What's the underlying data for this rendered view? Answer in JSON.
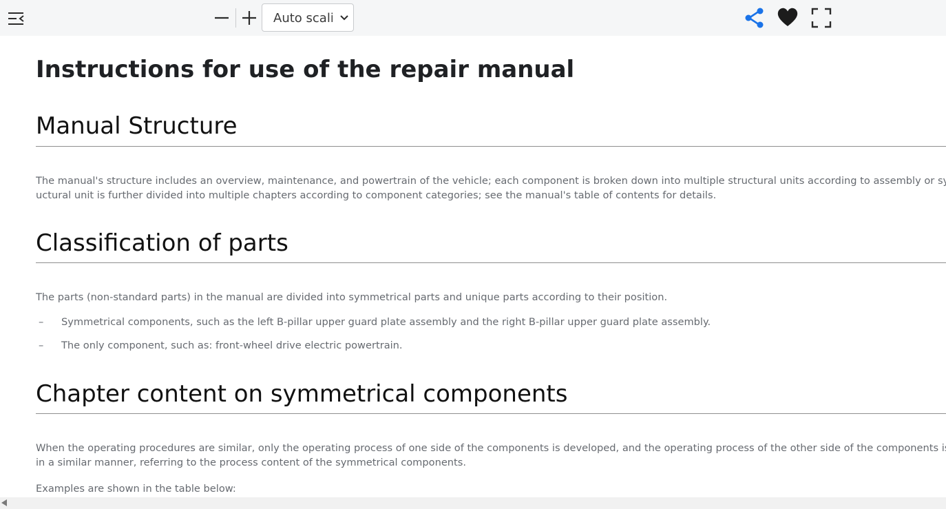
{
  "toolbar": {
    "sidebar_toggle_icon": "sidebar-toggle-icon",
    "zoom_out_icon": "minus-icon",
    "zoom_in_icon": "plus-icon",
    "scale_value": "Auto scaling",
    "share_icon": "share-icon",
    "favorite_icon": "heart-icon",
    "fullscreen_icon": "fullscreen-icon",
    "colors": {
      "share": "#1a73e8",
      "heart": "#1c1c1c",
      "icon": "#2b2b2b"
    }
  },
  "document": {
    "title": "Instructions for use of the repair manual",
    "sections": [
      {
        "heading": "Manual Structure",
        "paragraphs": [
          "The manual's structure includes an overview, maintenance, and powertrain of the vehicle; each component is broken down into multiple structural units according to assembly or system; each str",
          "uctural unit is further divided into multiple chapters according to component categories; see the manual's table of contents for details."
        ]
      },
      {
        "heading": "Classification of parts",
        "paragraphs": [
          "The parts (non-standard parts) in the manual are divided into symmetrical parts and unique parts according to their position."
        ],
        "bullets": [
          {
            "dash": "–",
            "text": "Symmetrical components, such as the left B-pillar upper guard plate assembly and the right B-pillar upper guard plate assembly."
          },
          {
            "dash": "–",
            "text": "The only component, such as: front-wheel drive electric powertrain."
          }
        ]
      },
      {
        "heading": "Chapter content on symmetrical components",
        "paragraphs": [
          "When the operating procedures are similar, only the operating process of one side of the components is developed, and the operating process of the other side of the components is carried out",
          "in a similar manner, referring to the process content of the symmetrical components."
        ],
        "after": "Examples are shown in the table below:"
      }
    ]
  }
}
